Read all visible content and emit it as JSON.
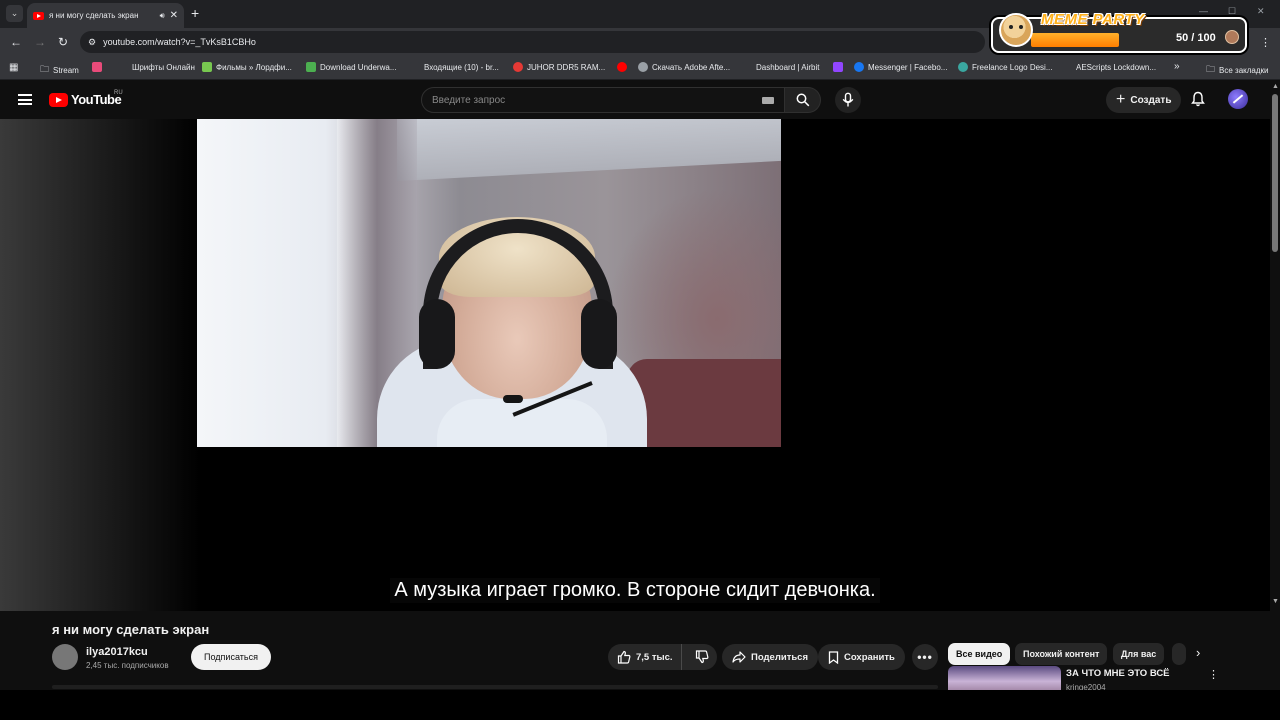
{
  "browser": {
    "tab": {
      "title": "я ни могу сделать экран",
      "audio_icon": "speaker-icon"
    },
    "url": "youtube.com/watch?v=_TvKsB1CBHo",
    "bookmarks": [
      {
        "label": "Stream",
        "icon": "folder-icon",
        "color": "#e8eaed"
      },
      {
        "label": "",
        "icon": "trio-icon",
        "color": "#e84b7a"
      },
      {
        "label": "Шрифты Онлайн",
        "icon": "fonts-icon",
        "color": "#35363a"
      },
      {
        "label": "Фильмы » Лордфи...",
        "icon": "film-icon",
        "color": "#78c850"
      },
      {
        "label": "Download Underwa...",
        "icon": "ae-icon",
        "color": "#4caf50"
      },
      {
        "label": "Входящие (10) - br...",
        "icon": "mail-icon",
        "color": "#35363a"
      },
      {
        "label": "JUHOR DDR5 RAM...",
        "icon": "shop-icon",
        "color": "#e53935"
      },
      {
        "label": "",
        "icon": "youtube-icon",
        "color": "#ff0000"
      },
      {
        "label": "Скачать Adobe Afte...",
        "icon": "globe-icon",
        "color": "#9aa0a6"
      },
      {
        "label": "Dashboard | Airbit",
        "icon": "airbit-icon",
        "color": "#35363a"
      },
      {
        "label": "",
        "icon": "twitch-icon",
        "color": "#9146ff"
      },
      {
        "label": "Messenger | Facebo...",
        "icon": "facebook-icon",
        "color": "#1877f2"
      },
      {
        "label": "Freelance Logo Desi...",
        "icon": "gear-icon",
        "color": "#3aa7a0"
      },
      {
        "label": "AEScripts Lockdown...",
        "icon": "aescripts-icon",
        "color": "#35363a"
      }
    ],
    "all_bookmarks_label": "Все закладки"
  },
  "meme_party": {
    "title": "MEME PARTY",
    "count": "50 / 100",
    "progress": 0.5
  },
  "youtube": {
    "logo_text": "YouTube",
    "region": "RU",
    "search_placeholder": "Введите запрос",
    "create_label": "Создать",
    "subtitle": "А музыка играет громко. В стороне сидит девчонка.",
    "video": {
      "title": "я ни могу сделать экран",
      "channel": "ilya2017kcu",
      "subscribers": "2,45 тыс. подписчиков",
      "subscribe_label": "Подписаться",
      "likes": "7,5 тыс.",
      "share_label": "Поделиться",
      "save_label": "Сохранить"
    },
    "chips": [
      "Все видео",
      "Похожий контент",
      "Для вас"
    ],
    "recommendation": {
      "title": "ЗА ЧТО МНЕ ЭТО ВСЁ",
      "channel": "kringe2004"
    }
  }
}
